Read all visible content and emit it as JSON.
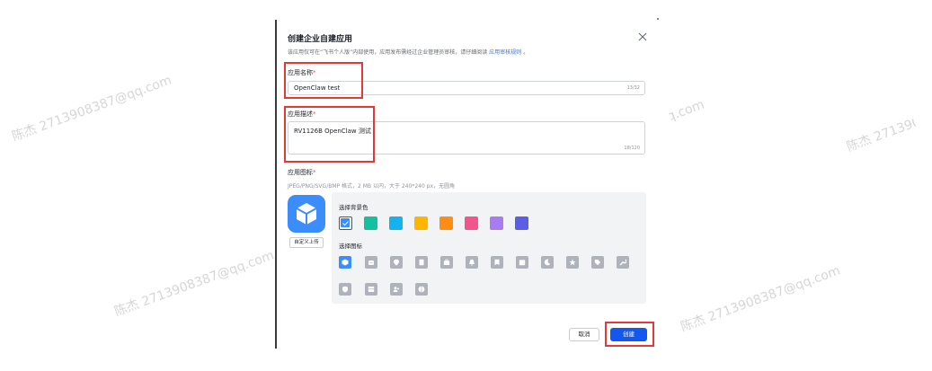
{
  "dialog": {
    "title": "创建企业自建应用",
    "subtitle_prefix": "该应用仅可在“飞书个人版”内部使用，应用发布需经过企业管理员审核，请仔细阅读",
    "subtitle_link": "应用审核规则",
    "subtitle_suffix": "。"
  },
  "name_field": {
    "label": "应用名称",
    "required_mark": "*",
    "value": "OpenClaw test",
    "counter": "13/32"
  },
  "desc_field": {
    "label": "应用描述",
    "required_mark": "*",
    "value": "RV1126B OpenClaw 测试",
    "counter": "18/120"
  },
  "icon_field": {
    "label": "应用图标",
    "required_mark": "*",
    "hint": "JPEG/PNG/SVG/BMP 格式，2 MB 以内，大于 240*240 px，无圆角",
    "upload_label": "自定义上传",
    "bg_title": "选择背景色",
    "icon_title": "选择图标",
    "bg_colors": [
      "#3c8dfc",
      "#14c0a0",
      "#14b3f0",
      "#ffb400",
      "#ff8c14",
      "#f0558c",
      "#a77cf0",
      "#5a5fe6"
    ],
    "selected_color": "#3c8dfc"
  },
  "footer": {
    "cancel_label": "取消",
    "create_label": "创建"
  },
  "colors": {
    "accent": "#1456f0",
    "highlight": "#e53935"
  },
  "watermark": "陈杰 2713908387@qq.com"
}
